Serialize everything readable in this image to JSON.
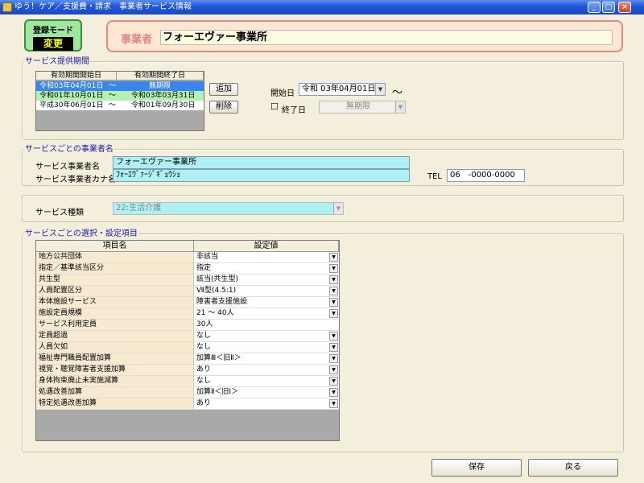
{
  "window": {
    "title": "ゆう！ケア／支援費・請求　事業者サービス情報",
    "minimize": "_",
    "maximize": "□",
    "close": "×"
  },
  "mode": {
    "label": "登録モード",
    "value": "変更"
  },
  "business": {
    "label": "事業者",
    "name": "フォーエヴァー事業所"
  },
  "period": {
    "legend": "サービス提供期間",
    "col_start": "有効期間開始日",
    "col_end": "有効期間終了日",
    "rows": [
      {
        "start": "令和03年04月01日",
        "tilde": "～",
        "end": "無期限"
      },
      {
        "start": "令和01年10月01日",
        "tilde": "～",
        "end": "令和03年03月31日"
      },
      {
        "start": "平成30年06月01日",
        "tilde": "～",
        "end": "令和01年09月30日"
      }
    ],
    "add_label": "追加",
    "delete_label": "削除",
    "start_label": "開始日",
    "start_value": "令和 03年04月01日",
    "wave": "～",
    "end_check": "☐",
    "end_label": "終了日",
    "end_value": "無期限"
  },
  "provider": {
    "legend": "サービスごとの事業者名",
    "name_label": "サービス事業者名",
    "name_value": "フォーエヴァー事業所",
    "kana_label": "サービス事業者カナ名",
    "kana_value": "ﾌｫｰｴｳﾞｧｰｼﾞｷﾞｮｳｼｮ",
    "tel_label": "TEL",
    "tel_value": "06　-0000-0000"
  },
  "service_type": {
    "label": "サービス種類",
    "value": "22:生活介護"
  },
  "settings": {
    "legend": "サービスごとの選択・設定項目",
    "col_name": "項目名",
    "col_value": "設定値",
    "rows": [
      {
        "name": "地方公共団体",
        "value": "非該当",
        "dropdown": true
      },
      {
        "name": "指定／基準該当区分",
        "value": "指定",
        "dropdown": true
      },
      {
        "name": "共生型",
        "value": "該当(共生型)",
        "dropdown": true
      },
      {
        "name": "人員配置区分",
        "value": "Ⅶ型(4.5:1)",
        "dropdown": true
      },
      {
        "name": "本体施設サービス",
        "value": "障害者支援施設",
        "dropdown": true
      },
      {
        "name": "施設定員規模",
        "value": "21 ～ 40人",
        "dropdown": true
      },
      {
        "name": "サービス利用定員",
        "value": "30人",
        "dropdown": false
      },
      {
        "name": "定員超過",
        "value": "なし",
        "dropdown": true
      },
      {
        "name": "人員欠如",
        "value": "なし",
        "dropdown": true
      },
      {
        "name": "福祉専門職員配置加算",
        "value": "加算Ⅲ＜旧Ⅱ＞",
        "dropdown": true
      },
      {
        "name": "視覚・聴覚障害者支援加算",
        "value": "あり",
        "dropdown": true
      },
      {
        "name": "身体拘束廃止未実施減算",
        "value": "なし",
        "dropdown": true
      },
      {
        "name": "処遇改善加算",
        "value": "加算Ⅱ＜旧Ⅰ＞",
        "dropdown": true
      },
      {
        "name": "特定処遇改善加算",
        "value": "あり",
        "dropdown": true
      }
    ]
  },
  "footer": {
    "save_label": "保存",
    "back_label": "戻る"
  },
  "colors": {
    "selected_row": "#3a86f0",
    "green_row": "#b3f0b3",
    "highlight_field": "#aef0f4"
  }
}
